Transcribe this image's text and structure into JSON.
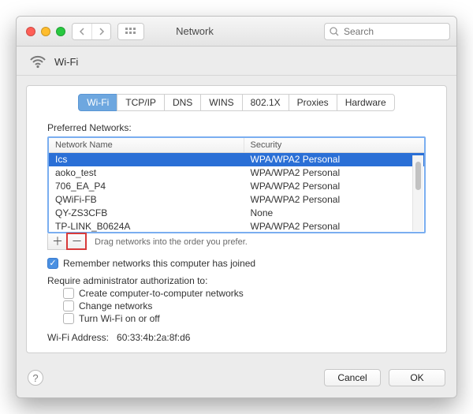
{
  "titlebar": {
    "title": "Network",
    "search_placeholder": "Search"
  },
  "header": {
    "section_label": "Wi-Fi"
  },
  "tabs": [
    "Wi-Fi",
    "TCP/IP",
    "DNS",
    "WINS",
    "802.1X",
    "Proxies",
    "Hardware"
  ],
  "preferred_label": "Preferred Networks:",
  "table": {
    "col_name": "Network Name",
    "col_security": "Security",
    "rows": [
      {
        "name": "Ics",
        "security": "WPA/WPA2 Personal",
        "selected": true
      },
      {
        "name": "aoko_test",
        "security": "WPA/WPA2 Personal",
        "selected": false
      },
      {
        "name": "706_EA_P4",
        "security": "WPA/WPA2 Personal",
        "selected": false
      },
      {
        "name": "QWiFi-FB",
        "security": "WPA/WPA2 Personal",
        "selected": false
      },
      {
        "name": "QY-ZS3CFB",
        "security": "None",
        "selected": false
      },
      {
        "name": "TP-LINK_B0624A",
        "security": "WPA/WPA2 Personal",
        "selected": false
      }
    ]
  },
  "drag_hint": "Drag networks into the order you prefer.",
  "remember_label": "Remember networks this computer has joined",
  "admin_label": "Require administrator authorization to:",
  "admin_opts": {
    "c2c": "Create computer-to-computer networks",
    "change": "Change networks",
    "onoff": "Turn Wi-Fi on or off"
  },
  "address": {
    "label": "Wi-Fi Address:",
    "value": "60:33:4b:2a:8f:d6"
  },
  "buttons": {
    "cancel": "Cancel",
    "ok": "OK"
  }
}
